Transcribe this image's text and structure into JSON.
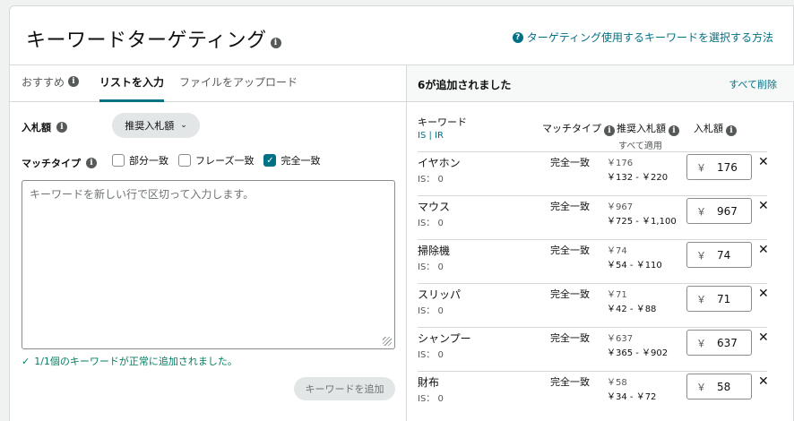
{
  "header": {
    "title": "キーワードターゲティング",
    "help_link": "ターゲティング使用するキーワードを選択する方法"
  },
  "tabs": [
    {
      "label": "おすすめ"
    },
    {
      "label": "リストを入力"
    },
    {
      "label": "ファイルをアップロード"
    }
  ],
  "form": {
    "bid_label": "入札額",
    "bid_dropdown": "推奨入札額",
    "match_label": "マッチタイプ",
    "match_options": [
      {
        "label": "部分一致",
        "checked": false
      },
      {
        "label": "フレーズ一致",
        "checked": false
      },
      {
        "label": "完全一致",
        "checked": true
      }
    ],
    "textarea_placeholder": "キーワードを新しい行で区切って入力します。",
    "success_message": "1/1個のキーワードが正常に追加されました。",
    "add_button": "キーワードを追加"
  },
  "added": {
    "count_label": "6が追加されました",
    "remove_all": "すべて削除",
    "columns": {
      "keyword": "キーワード",
      "keyword_sub": "IS | IR",
      "match_type": "マッチタイプ",
      "suggested_bid": "推奨入札額",
      "apply_all": "すべて適用",
      "bid": "入札額"
    },
    "rows": [
      {
        "keyword": "イヤホン",
        "is": "IS： 0",
        "match": "完全一致",
        "suggested": "￥176",
        "range": "￥132 - ￥220",
        "currency": "￥",
        "bid": "176"
      },
      {
        "keyword": "マウス",
        "is": "IS： 0",
        "match": "完全一致",
        "suggested": "￥967",
        "range": "￥725 - ￥1,100",
        "currency": "￥",
        "bid": "967"
      },
      {
        "keyword": "掃除機",
        "is": "IS： 0",
        "match": "完全一致",
        "suggested": "￥74",
        "range": "￥54 - ￥110",
        "currency": "￥",
        "bid": "74"
      },
      {
        "keyword": "スリッパ",
        "is": "IS： 0",
        "match": "完全一致",
        "suggested": "￥71",
        "range": "￥42 - ￥88",
        "currency": "￥",
        "bid": "71"
      },
      {
        "keyword": "シャンプー",
        "is": "IS： 0",
        "match": "完全一致",
        "suggested": "￥637",
        "range": "￥365 - ￥902",
        "currency": "￥",
        "bid": "637"
      },
      {
        "keyword": "財布",
        "is": "IS： 0",
        "match": "完全一致",
        "suggested": "￥58",
        "range": "￥34 - ￥72",
        "currency": "￥",
        "bid": "58"
      }
    ]
  },
  "colors": {
    "accent": "#007185",
    "success": "#067d62",
    "border": "#d5d9d9"
  },
  "icons": {
    "info": "info-icon",
    "help": "help-icon",
    "chevron": "chevron-down-icon",
    "check": "check-icon",
    "remove": "close-icon"
  }
}
